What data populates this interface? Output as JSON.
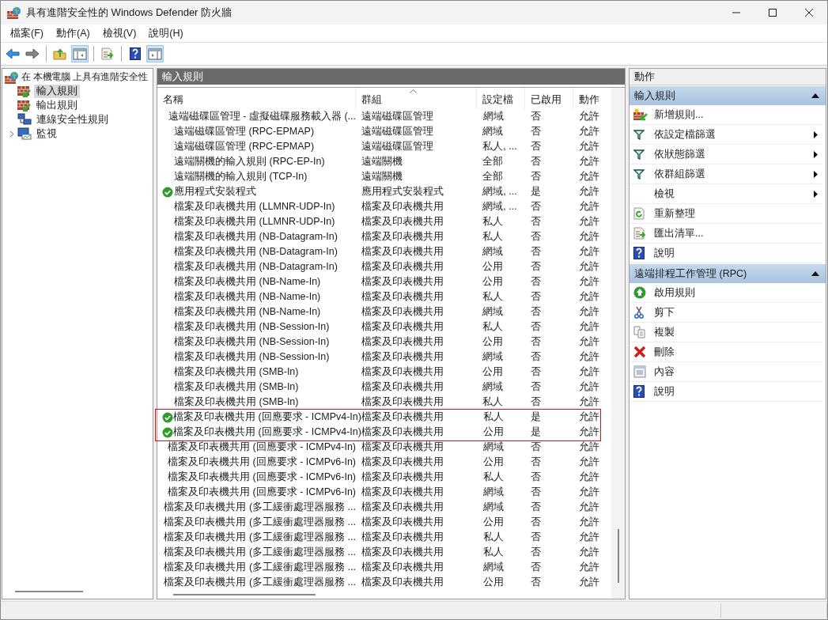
{
  "window": {
    "title": "具有進階安全性的 Windows Defender 防火牆"
  },
  "menu": [
    "檔案(F)",
    "動作(A)",
    "檢視(V)",
    "說明(H)"
  ],
  "toolbar": [
    {
      "pressed": false
    },
    {
      "pressed": false
    },
    {
      "pressed": false
    },
    {
      "pressed": true
    },
    {
      "pressed": false
    },
    {
      "pressed": false
    },
    {
      "pressed": true
    }
  ],
  "tree": {
    "label": "在 本機電腦 上具有進階安全性",
    "children": [
      {
        "label": "輸入規則",
        "selected": true,
        "expandable": false
      },
      {
        "label": "輸出規則",
        "selected": false,
        "expandable": false
      },
      {
        "label": "連線安全性規則",
        "selected": false,
        "expandable": false
      },
      {
        "label": "監視",
        "selected": false,
        "expandable": true
      }
    ]
  },
  "table": {
    "title": "輸入規則",
    "columns": [
      {
        "label": "名稱",
        "sorted": false
      },
      {
        "label": "群組",
        "sorted": true
      },
      {
        "label": "設定檔",
        "sorted": false
      },
      {
        "label": "已啟用",
        "sorted": false
      },
      {
        "label": "動作",
        "sorted": false
      }
    ],
    "rows": [
      {
        "enabled": false,
        "highlighted": false,
        "cells": [
          "遠端磁碟區管理 - 虛擬磁碟服務載入器 (...",
          "遠端磁碟區管理",
          "網域",
          "否",
          "允許"
        ]
      },
      {
        "enabled": false,
        "highlighted": false,
        "cells": [
          "遠端磁碟區管理 (RPC-EPMAP)",
          "遠端磁碟區管理",
          "網域",
          "否",
          "允許"
        ]
      },
      {
        "enabled": false,
        "highlighted": false,
        "cells": [
          "遠端磁碟區管理 (RPC-EPMAP)",
          "遠端磁碟區管理",
          "私人, ...",
          "否",
          "允許"
        ]
      },
      {
        "enabled": false,
        "highlighted": false,
        "cells": [
          "遠端關機的輸入規則 (RPC-EP-In)",
          "遠端關機",
          "全部",
          "否",
          "允許"
        ]
      },
      {
        "enabled": false,
        "highlighted": false,
        "cells": [
          "遠端關機的輸入規則 (TCP-In)",
          "遠端關機",
          "全部",
          "否",
          "允許"
        ]
      },
      {
        "enabled": true,
        "highlighted": false,
        "cells": [
          "應用程式安裝程式",
          "應用程式安裝程式",
          "網域, ...",
          "是",
          "允許"
        ]
      },
      {
        "enabled": false,
        "highlighted": false,
        "cells": [
          "檔案及印表機共用 (LLMNR-UDP-In)",
          "檔案及印表機共用",
          "網域, ...",
          "否",
          "允許"
        ]
      },
      {
        "enabled": false,
        "highlighted": false,
        "cells": [
          "檔案及印表機共用 (LLMNR-UDP-In)",
          "檔案及印表機共用",
          "私人",
          "否",
          "允許"
        ]
      },
      {
        "enabled": false,
        "highlighted": false,
        "cells": [
          "檔案及印表機共用 (NB-Datagram-In)",
          "檔案及印表機共用",
          "私人",
          "否",
          "允許"
        ]
      },
      {
        "enabled": false,
        "highlighted": false,
        "cells": [
          "檔案及印表機共用 (NB-Datagram-In)",
          "檔案及印表機共用",
          "網域",
          "否",
          "允許"
        ]
      },
      {
        "enabled": false,
        "highlighted": false,
        "cells": [
          "檔案及印表機共用 (NB-Datagram-In)",
          "檔案及印表機共用",
          "公用",
          "否",
          "允許"
        ]
      },
      {
        "enabled": false,
        "highlighted": false,
        "cells": [
          "檔案及印表機共用 (NB-Name-In)",
          "檔案及印表機共用",
          "公用",
          "否",
          "允許"
        ]
      },
      {
        "enabled": false,
        "highlighted": false,
        "cells": [
          "檔案及印表機共用 (NB-Name-In)",
          "檔案及印表機共用",
          "私人",
          "否",
          "允許"
        ]
      },
      {
        "enabled": false,
        "highlighted": false,
        "cells": [
          "檔案及印表機共用 (NB-Name-In)",
          "檔案及印表機共用",
          "網域",
          "否",
          "允許"
        ]
      },
      {
        "enabled": false,
        "highlighted": false,
        "cells": [
          "檔案及印表機共用 (NB-Session-In)",
          "檔案及印表機共用",
          "私人",
          "否",
          "允許"
        ]
      },
      {
        "enabled": false,
        "highlighted": false,
        "cells": [
          "檔案及印表機共用 (NB-Session-In)",
          "檔案及印表機共用",
          "公用",
          "否",
          "允許"
        ]
      },
      {
        "enabled": false,
        "highlighted": false,
        "cells": [
          "檔案及印表機共用 (NB-Session-In)",
          "檔案及印表機共用",
          "網域",
          "否",
          "允許"
        ]
      },
      {
        "enabled": false,
        "highlighted": false,
        "cells": [
          "檔案及印表機共用 (SMB-In)",
          "檔案及印表機共用",
          "公用",
          "否",
          "允許"
        ]
      },
      {
        "enabled": false,
        "highlighted": false,
        "cells": [
          "檔案及印表機共用 (SMB-In)",
          "檔案及印表機共用",
          "網域",
          "否",
          "允許"
        ]
      },
      {
        "enabled": false,
        "highlighted": false,
        "cells": [
          "檔案及印表機共用 (SMB-In)",
          "檔案及印表機共用",
          "私人",
          "否",
          "允許"
        ]
      },
      {
        "enabled": true,
        "highlighted": true,
        "cells": [
          "檔案及印表機共用 (回應要求 - ICMPv4-In)",
          "檔案及印表機共用",
          "私人",
          "是",
          "允許"
        ]
      },
      {
        "enabled": true,
        "highlighted": true,
        "cells": [
          "檔案及印表機共用 (回應要求 - ICMPv4-In)",
          "檔案及印表機共用",
          "公用",
          "是",
          "允許"
        ]
      },
      {
        "enabled": false,
        "highlighted": false,
        "cells": [
          "檔案及印表機共用 (回應要求 - ICMPv4-In)",
          "檔案及印表機共用",
          "網域",
          "否",
          "允許"
        ]
      },
      {
        "enabled": false,
        "highlighted": false,
        "cells": [
          "檔案及印表機共用 (回應要求 - ICMPv6-In)",
          "檔案及印表機共用",
          "公用",
          "否",
          "允許"
        ]
      },
      {
        "enabled": false,
        "highlighted": false,
        "cells": [
          "檔案及印表機共用 (回應要求 - ICMPv6-In)",
          "檔案及印表機共用",
          "私人",
          "否",
          "允許"
        ]
      },
      {
        "enabled": false,
        "highlighted": false,
        "cells": [
          "檔案及印表機共用 (回應要求 - ICMPv6-In)",
          "檔案及印表機共用",
          "網域",
          "否",
          "允許"
        ]
      },
      {
        "enabled": false,
        "highlighted": false,
        "cells": [
          "檔案及印表機共用 (多工緩衝處理器服務 ...",
          "檔案及印表機共用",
          "網域",
          "否",
          "允許"
        ]
      },
      {
        "enabled": false,
        "highlighted": false,
        "cells": [
          "檔案及印表機共用 (多工緩衝處理器服務 ...",
          "檔案及印表機共用",
          "公用",
          "否",
          "允許"
        ]
      },
      {
        "enabled": false,
        "highlighted": false,
        "cells": [
          "檔案及印表機共用 (多工緩衝處理器服務 ...",
          "檔案及印表機共用",
          "私人",
          "否",
          "允許"
        ]
      },
      {
        "enabled": false,
        "highlighted": false,
        "cells": [
          "檔案及印表機共用 (多工緩衝處理器服務 ...",
          "檔案及印表機共用",
          "私人",
          "否",
          "允許"
        ]
      },
      {
        "enabled": false,
        "highlighted": false,
        "cells": [
          "檔案及印表機共用 (多工緩衝處理器服務 ...",
          "檔案及印表機共用",
          "網域",
          "否",
          "允許"
        ]
      },
      {
        "enabled": false,
        "highlighted": false,
        "cells": [
          "檔案及印表機共用 (多工緩衝處理器服務 ...",
          "檔案及印表機共用",
          "公用",
          "否",
          "允許"
        ]
      }
    ]
  },
  "actions": {
    "title": "動作",
    "sections": [
      {
        "title": "輸入規則",
        "expanded": true,
        "items": [
          {
            "label": "新增規則...",
            "submenu": false
          },
          {
            "label": "依設定檔篩選",
            "submenu": true
          },
          {
            "label": "依狀態篩選",
            "submenu": true
          },
          {
            "label": "依群組篩選",
            "submenu": true
          },
          {
            "label": "檢視",
            "submenu": true
          },
          {
            "label": "重新整理",
            "submenu": false
          },
          {
            "label": "匯出清單...",
            "submenu": false
          },
          {
            "label": "說明",
            "submenu": false
          }
        ]
      },
      {
        "title": "遠端排程工作管理 (RPC)",
        "expanded": true,
        "items": [
          {
            "label": "啟用規則",
            "submenu": false
          },
          {
            "label": "剪下",
            "submenu": false
          },
          {
            "label": "複製",
            "submenu": false
          },
          {
            "label": "刪除",
            "submenu": false
          },
          {
            "label": "內容",
            "submenu": false
          },
          {
            "label": "說明",
            "submenu": false
          }
        ]
      }
    ]
  }
}
